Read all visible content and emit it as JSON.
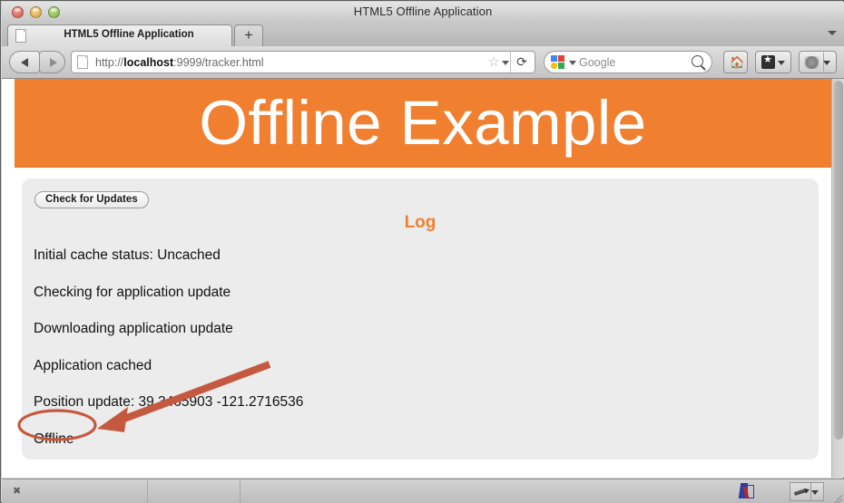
{
  "window": {
    "title": "HTML5 Offline Application",
    "traffic_lights": [
      "close",
      "minimize",
      "maximize"
    ]
  },
  "tabs": {
    "items": [
      {
        "label": "HTML5 Offline Application",
        "favicon": "document-icon",
        "active": true
      }
    ],
    "new_tab_label": "+",
    "tab_list_icon": "chevron-down-icon"
  },
  "toolbar": {
    "back_icon": "back-arrow-icon",
    "forward_icon": "forward-arrow-icon",
    "url_icon": "page-icon",
    "url_prefix": "http://",
    "url_host": "localhost",
    "url_suffix": ":9999/tracker.html",
    "url_full": "http://localhost:9999/tracker.html",
    "bookmark_star_icon": "star-icon",
    "bookmark_caret_icon": "chevron-down-icon",
    "reload_icon": "⟳",
    "search": {
      "engine": "Google",
      "placeholder": "Google",
      "value": "",
      "logo_icon": "google-logo-icon",
      "caret_icon": "chevron-down-icon",
      "magnifier_icon": "search-icon"
    },
    "home_icon": "⌂",
    "bookmarks_icon": "bookmarks-star-icon",
    "tools_icon": "tools-icon",
    "tools_caret_icon": "chevron-down-icon"
  },
  "page": {
    "banner_title": "Offline Example",
    "banner_color": "#f07f30",
    "panel_color": "#ecececec",
    "update_button": "Check for Updates",
    "log_heading": "Log",
    "log_heading_color": "#f07f30",
    "log_lines": [
      "Initial cache status: Uncached",
      "Checking for application update",
      "Downloading application update",
      "Application cached",
      "Position update: 39.3465903 -121.2716536",
      "Offline"
    ]
  },
  "annotations": {
    "highlight_color": "#c5593f",
    "ellipse_target": "Offline",
    "arrow": "arrow-pointing-to-offline"
  },
  "statusbar": {
    "left_icon": "move-handle-icon",
    "ruler_icon": "ruler-icon",
    "pen_icon": "pen-tool-icon",
    "pen_caret_icon": "chevron-down-icon",
    "resize_grip_icon": "resize-grip-icon"
  }
}
